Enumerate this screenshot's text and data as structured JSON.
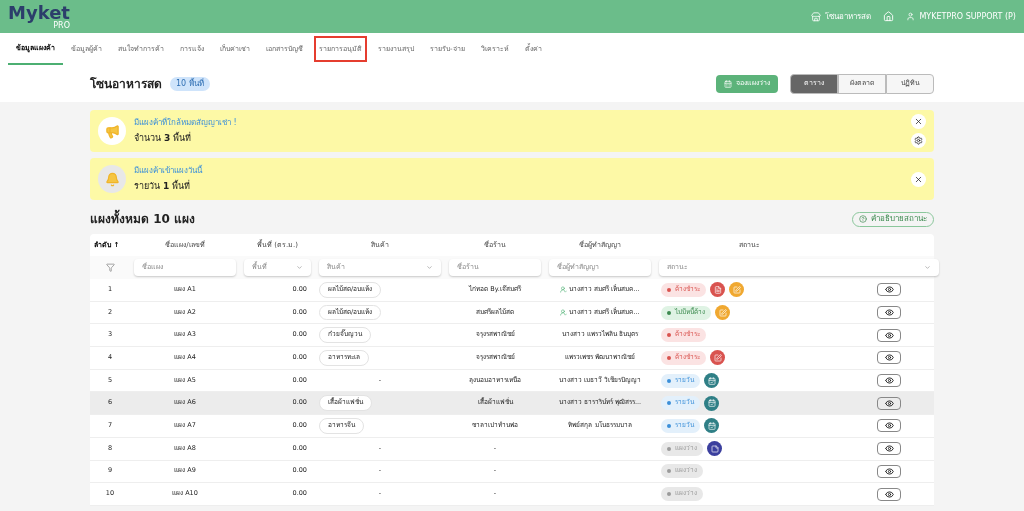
{
  "header": {
    "logo": "Myket",
    "logo_sub": "PRO",
    "zone": "โซนอาหารสด",
    "user": "MYKETPRO SUPPORT (P)"
  },
  "tabs": [
    {
      "label": "ข้อมูลแผงค้า",
      "selected": true,
      "highlighted": false
    },
    {
      "label": "ข้อมูลผู้ค้า",
      "selected": false,
      "highlighted": false
    },
    {
      "label": "สนใจทำการค้า",
      "selected": false,
      "highlighted": false
    },
    {
      "label": "การแจ้ง",
      "selected": false,
      "highlighted": false
    },
    {
      "label": "เก็บค่าเช่า",
      "selected": false,
      "highlighted": false
    },
    {
      "label": "เอกสารบัญชี",
      "selected": false,
      "highlighted": false
    },
    {
      "label": "รายการอนุมัติ",
      "selected": false,
      "highlighted": true
    },
    {
      "label": "รายงานสรุป",
      "selected": false,
      "highlighted": false
    },
    {
      "label": "รายรับ-จ่าย",
      "selected": false,
      "highlighted": false
    },
    {
      "label": "วิเคราะห์",
      "selected": false,
      "highlighted": false
    },
    {
      "label": "ตั้งค่า",
      "selected": false,
      "highlighted": false
    }
  ],
  "page": {
    "title": "โซนอาหารสด",
    "badge": "10 พื้นที่",
    "book_button": "จองแผงว่าง",
    "views": [
      {
        "label": "ตาราง",
        "selected": true
      },
      {
        "label": "ผังตลาด",
        "selected": false
      },
      {
        "label": "ปฏิทิน",
        "selected": false
      }
    ]
  },
  "alerts": [
    {
      "kind": "megaphone",
      "title": "มีแผงค้าที่ใกล้หมดสัญญาเช่า !",
      "text": "จำนวน **3** พื้นที่",
      "settings": true
    },
    {
      "kind": "bell",
      "title": "มีแผงค้าเข้าแผงวันนี้",
      "text": "รายวัน **1** พื้นที่",
      "settings": false
    }
  ],
  "section": {
    "title": "แผงทั้งหมด 10 แผง",
    "help_button": "คำอธิบายสถานะ"
  },
  "table": {
    "columns": [
      "ลำดับ ↑",
      "ชื่อแผง/เลขที่",
      "พื้นที่ (ตร.ม.)",
      "สินค้า",
      "ชื่อร้าน",
      "ชื่อผู้ทำสัญญา",
      "สถานะ"
    ],
    "filters": [
      {
        "kind": "text",
        "placeholder": "ชื่อแผง"
      },
      {
        "kind": "select",
        "placeholder": "พื้นที่"
      },
      {
        "kind": "select",
        "placeholder": "สินค้า"
      },
      {
        "kind": "text",
        "placeholder": "ชื่อร้าน"
      },
      {
        "kind": "text",
        "placeholder": "ชื่อผู้ทำสัญญา"
      },
      {
        "kind": "select",
        "placeholder": "สถานะ"
      }
    ],
    "rows": [
      {
        "no": "1",
        "stall": "แผง A1",
        "area": "0.00",
        "product": "ผลไม้สด/อบแห้ง",
        "shop": "ไก่ทอด By.เจ๊สมศรี",
        "contractor": "นางสาว สมศรี เห็นสมค...",
        "transferred": true,
        "status": {
          "kind": "overdue",
          "label": "ค้างชำระ"
        },
        "icons": [
          {
            "kind": "document",
            "color": "#d9534f"
          },
          {
            "kind": "edit",
            "color": "#f0a830"
          }
        ],
        "highlighted": false
      },
      {
        "no": "2",
        "stall": "แผง A2",
        "area": "0.00",
        "product": "ผลไม้สด/อบแห้ง",
        "shop": "สมศรีผลไม้สด",
        "contractor": "นางสาว สมศรี เห็นสมค...",
        "transferred": true,
        "status": {
          "kind": "paid",
          "label": "ไม่มีหนี้ค้าง"
        },
        "icons": [
          {
            "kind": "edit",
            "color": "#f0a830"
          }
        ],
        "highlighted": false
      },
      {
        "no": "3",
        "stall": "แผง A3",
        "area": "0.00",
        "product": "ก๋วยจั๊บญวน",
        "shop": "จรุงรสพาณิชย์",
        "contractor": "นางสาว แพรวไพลิน ธินบุตร",
        "transferred": false,
        "status": {
          "kind": "overdue",
          "label": "ค้างชำระ"
        },
        "icons": [],
        "highlighted": false
      },
      {
        "no": "4",
        "stall": "แผง A4",
        "area": "0.00",
        "product": "อาหารทะเล",
        "shop": "จรุงรสพาณิชย์",
        "contractor": "แพรวเพชร พัฒนาพาณิชย์",
        "transferred": false,
        "status": {
          "kind": "overdue",
          "label": "ค้างชำระ"
        },
        "icons": [
          {
            "kind": "edit",
            "color": "#d9534f"
          }
        ],
        "highlighted": false
      },
      {
        "no": "5",
        "stall": "แผง A5",
        "area": "0.00",
        "product": "-",
        "shop": "ลุงนอมอาหารเหนือ",
        "contractor": "นางสาว เมธาวี วิเชียรปัญญา",
        "transferred": false,
        "status": {
          "kind": "daily",
          "label": "รายวัน"
        },
        "icons": [
          {
            "kind": "calendar",
            "color": "#2f7f86"
          }
        ],
        "highlighted": false
      },
      {
        "no": "6",
        "stall": "แผง A6",
        "area": "0.00",
        "product": "เสื้อผ้าแฟชั่น",
        "shop": "เสื้อผ้าแฟชั่น",
        "contractor": "นางสาว ธาราริน์ทร์ พุฒิสรร...",
        "transferred": false,
        "status": {
          "kind": "daily",
          "label": "รายวัน"
        },
        "icons": [
          {
            "kind": "calendar",
            "color": "#2f7f86"
          }
        ],
        "highlighted": true
      },
      {
        "no": "7",
        "stall": "แผง A7",
        "area": "0.00",
        "product": "อาหารจีน",
        "shop": "ซาลาเปาทำนพ่อ",
        "contractor": "ทิพย์สกุล มโนธรรมบาล",
        "transferred": false,
        "status": {
          "kind": "daily",
          "label": "รายวัน"
        },
        "icons": [
          {
            "kind": "calendar",
            "color": "#2f7f86"
          }
        ],
        "highlighted": false
      },
      {
        "no": "8",
        "stall": "แผง A8",
        "area": "0.00",
        "product": "-",
        "shop": "-",
        "status": {
          "kind": "vacant",
          "label": "แผงว่าง"
        },
        "transferred": false,
        "icons": [
          {
            "kind": "note",
            "color": "#3b3f9e"
          }
        ],
        "highlighted": false
      },
      {
        "no": "9",
        "stall": "แผง A9",
        "area": "0.00",
        "product": "-",
        "shop": "-",
        "status": {
          "kind": "vacant",
          "label": "แผงว่าง"
        },
        "transferred": false,
        "icons": [],
        "highlighted": false
      },
      {
        "no": "10",
        "stall": "แผง A10",
        "area": "0.00",
        "product": "-",
        "shop": "-",
        "status": {
          "kind": "vacant",
          "label": "แผงว่าง"
        },
        "transferred": false,
        "icons": [],
        "highlighted": false
      }
    ]
  }
}
